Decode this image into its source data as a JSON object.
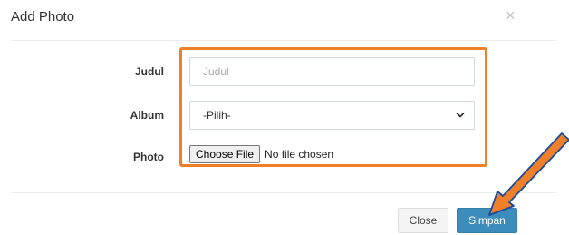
{
  "modal": {
    "title": "Add Photo",
    "close_icon": "×"
  },
  "form": {
    "judul": {
      "label": "Judul",
      "placeholder": "Judul",
      "value": ""
    },
    "album": {
      "label": "Album",
      "selected": "-Pilih-"
    },
    "photo": {
      "label": "Photo",
      "button_label": "Choose File",
      "status": "No file chosen"
    }
  },
  "footer": {
    "close_label": "Close",
    "save_label": "Simpan"
  },
  "colors": {
    "highlight": "#f07f2a",
    "primary": "#3c8dbc"
  },
  "icons": {
    "close": "close-icon",
    "select": "chevron-down-icon",
    "annotation": "arrow-icon"
  }
}
